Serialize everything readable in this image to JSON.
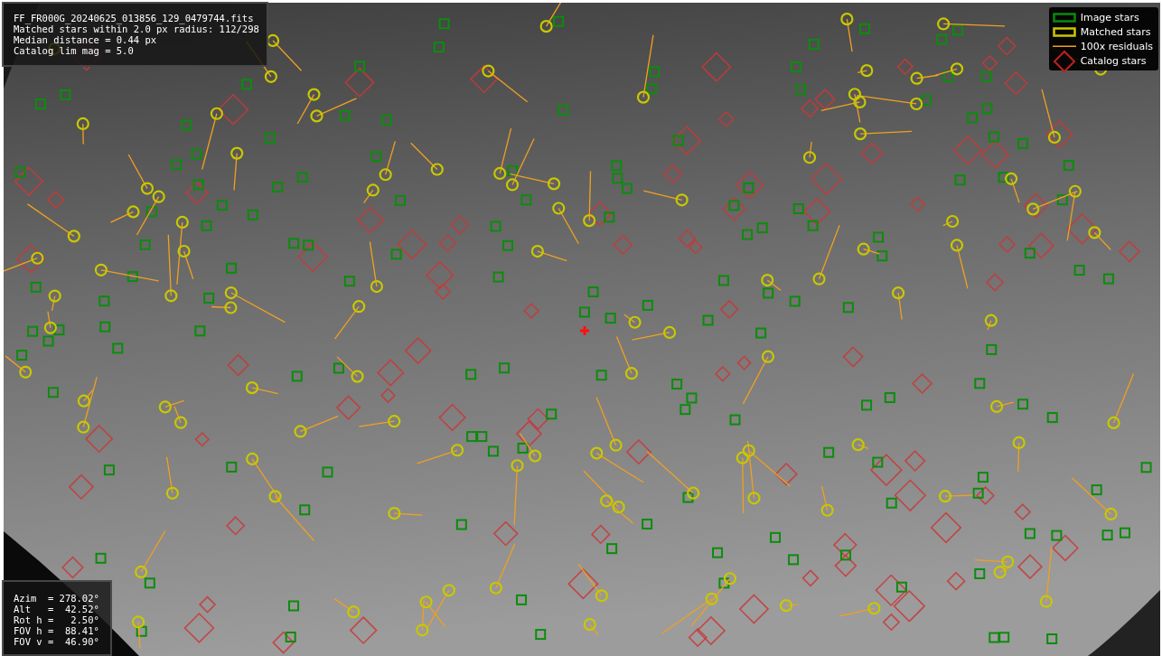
{
  "info_box": {
    "lines": [
      "FF_FR000G_20240625_013856_129_0479744.fits",
      "Matched stars within 2.0 px radius: 112/298",
      "Median distance = 0.44 px",
      "Catalog lim mag = 5.0"
    ]
  },
  "legend": [
    {
      "kind": "image",
      "label": "Image stars"
    },
    {
      "kind": "matched",
      "label": "Matched stars"
    },
    {
      "kind": "residual",
      "label": "100x residuals"
    },
    {
      "kind": "catalog",
      "label": "Catalog stars"
    }
  ],
  "pointing_box": {
    "lines": [
      "Azim  = 278.02°",
      "Alt   =  42.52°",
      "Rot h =   2.50°",
      "FOV h =  88.41°",
      "FOV v =  46.90°"
    ]
  }
}
